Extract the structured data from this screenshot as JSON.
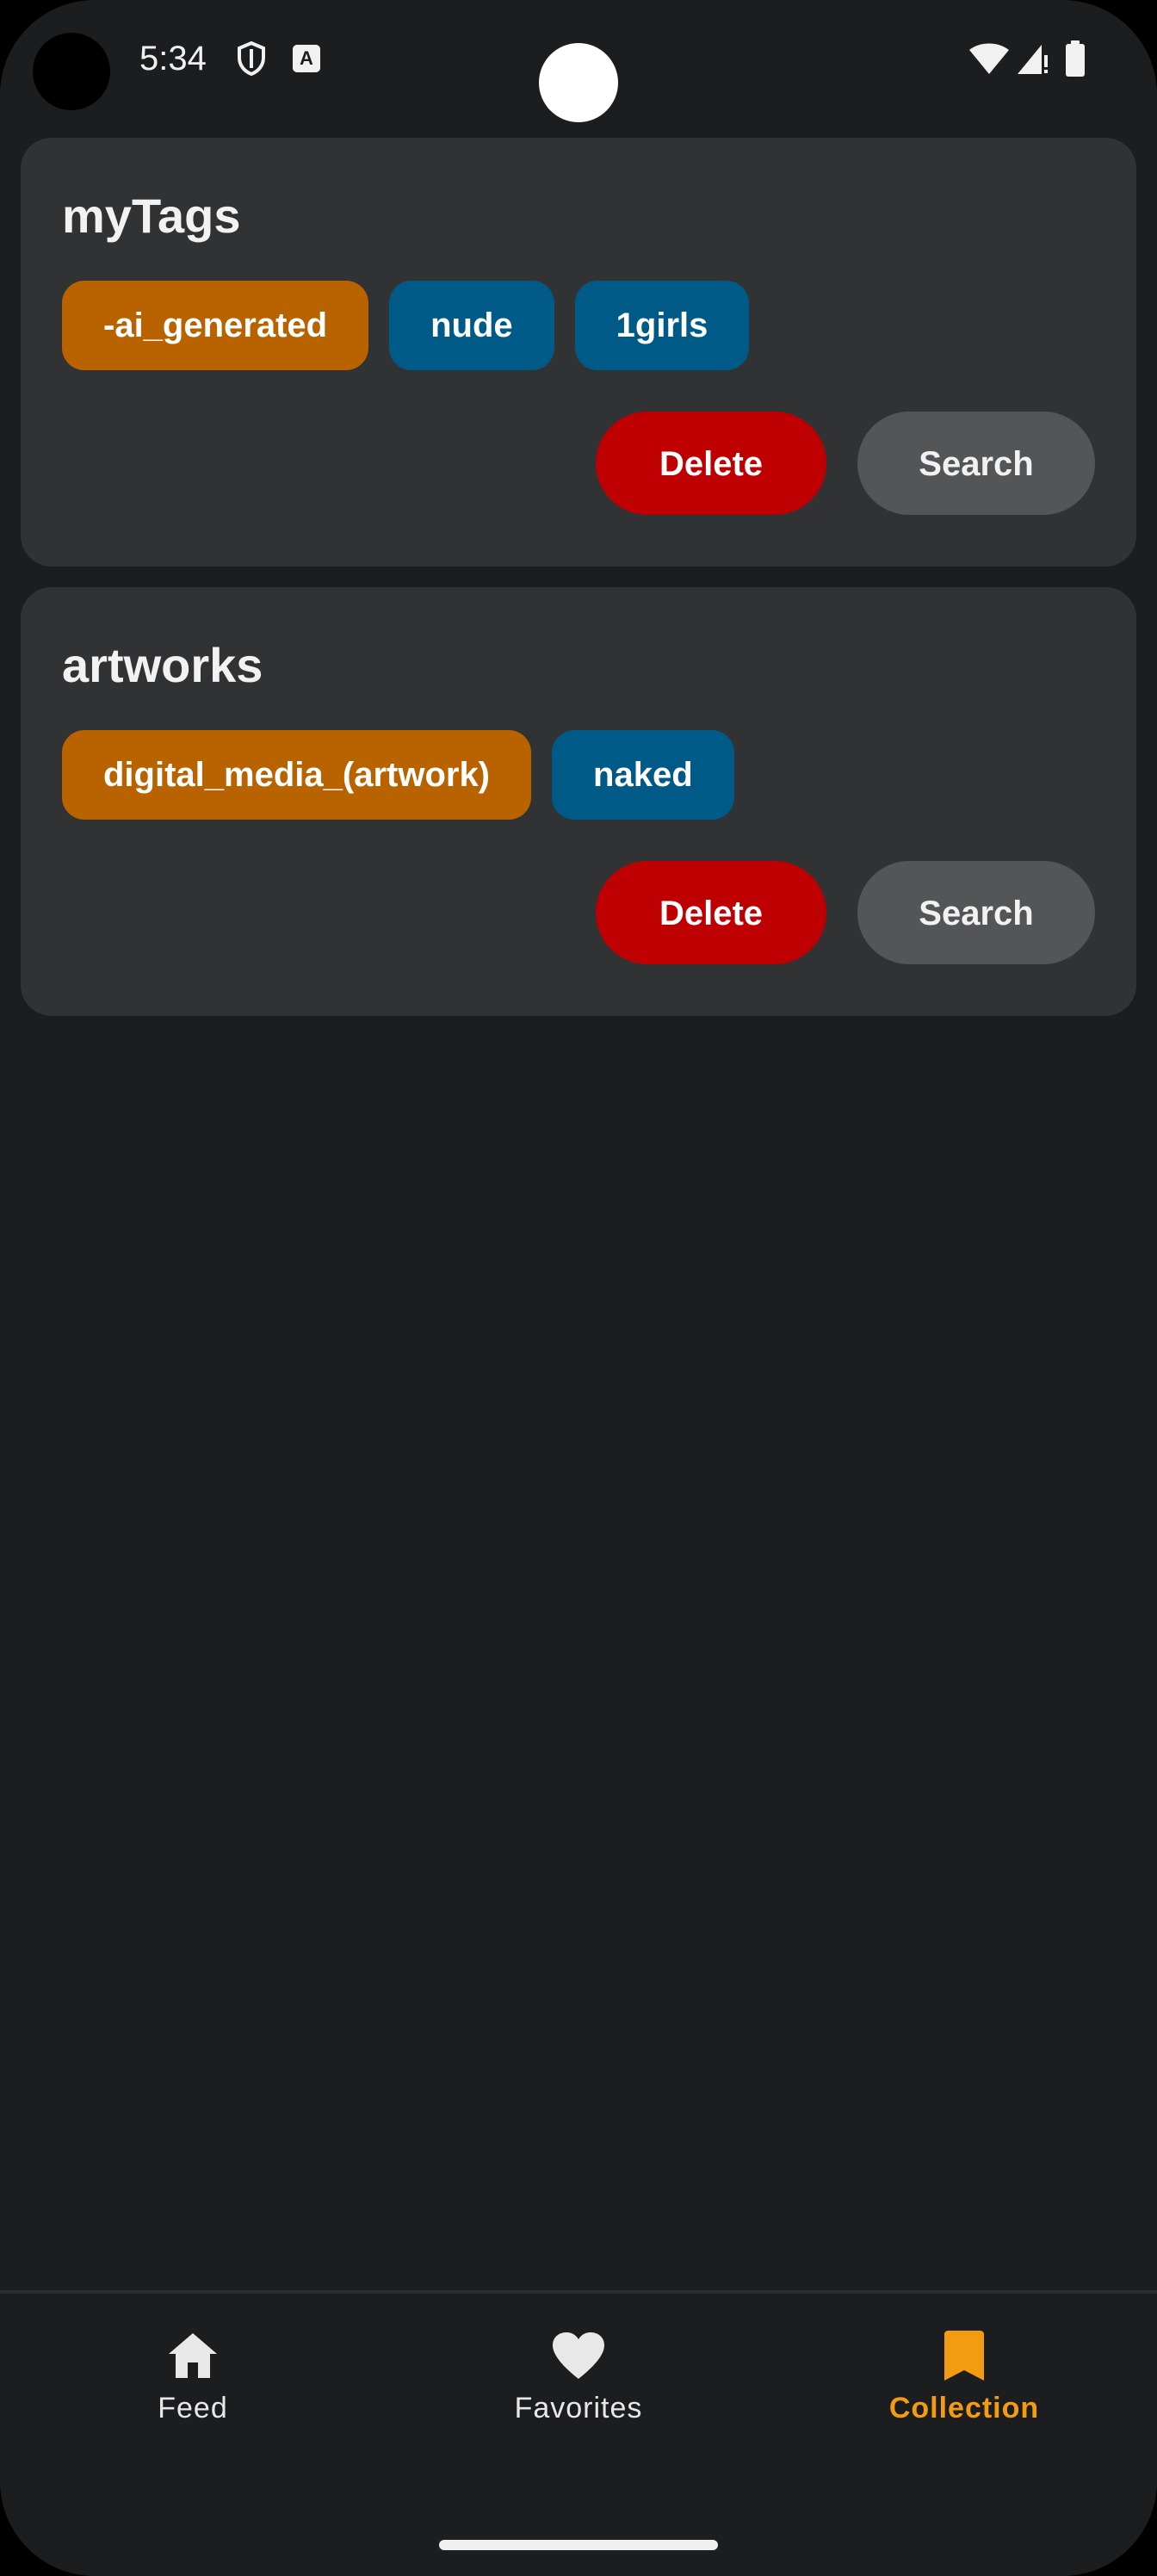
{
  "status_bar": {
    "time": "5:34",
    "icons": [
      "shield-icon",
      "a-icon",
      "wifi-icon",
      "signal-icon",
      "battery-icon"
    ],
    "a_icon_letter": "A"
  },
  "collections": [
    {
      "title": "myTags",
      "tags": [
        {
          "label": "-ai_generated",
          "color": "orange"
        },
        {
          "label": "nude",
          "color": "blue"
        },
        {
          "label": "1girls",
          "color": "blue"
        }
      ],
      "delete_label": "Delete",
      "search_label": "Search"
    },
    {
      "title": "artworks",
      "tags": [
        {
          "label": "digital_media_(artwork)",
          "color": "orange"
        },
        {
          "label": "naked",
          "color": "blue"
        }
      ],
      "delete_label": "Delete",
      "search_label": "Search"
    }
  ],
  "bottom_nav": {
    "items": [
      {
        "label": "Feed",
        "icon": "home-icon",
        "active": false
      },
      {
        "label": "Favorites",
        "icon": "heart-icon",
        "active": false
      },
      {
        "label": "Collection",
        "icon": "bookmark-icon",
        "active": true
      }
    ]
  },
  "colors": {
    "background": "#1c1d1f",
    "card": "#313234",
    "tag_orange": "#b86200",
    "tag_blue": "#005a87",
    "delete": "#be0003",
    "search": "#545557",
    "accent": "#f39c12"
  }
}
